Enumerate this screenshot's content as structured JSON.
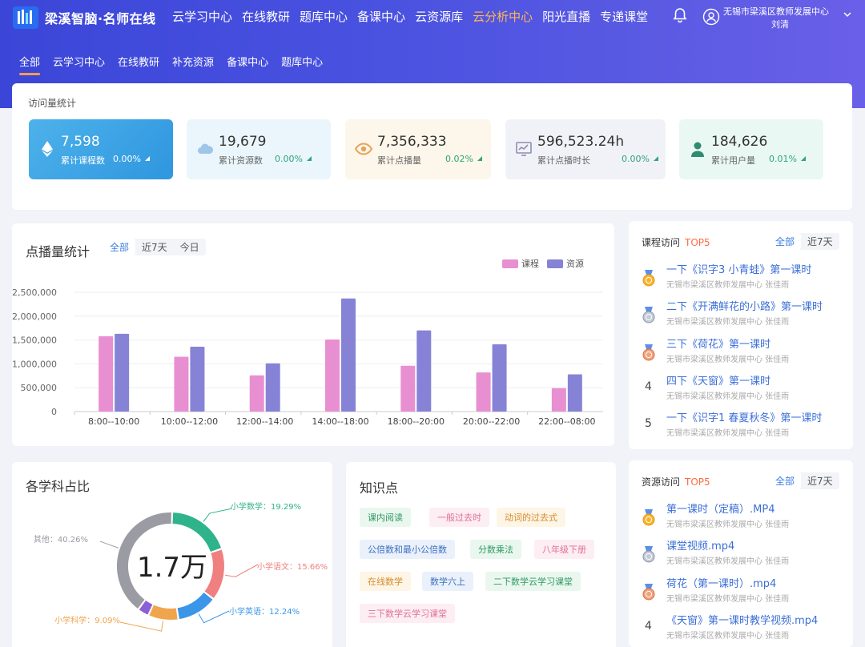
{
  "header": {
    "logo_text": "梁溪智脑·名师在线",
    "nav": [
      "云学习中心",
      "在线教研",
      "题库中心",
      "备课中心",
      "云资源库",
      "云分析中心",
      "阳光直播",
      "专递课堂"
    ],
    "active_nav": "云分析中心",
    "user_org": "无锡市梁溪区教师发展中心",
    "user_name": "刘清"
  },
  "subnav": {
    "items": [
      "全部",
      "云学习中心",
      "在线教研",
      "补充资源",
      "备课中心",
      "题库中心"
    ],
    "active": "全部"
  },
  "stats": {
    "title": "访问量统计",
    "cards": [
      {
        "value": "7,598",
        "label": "累计课程数",
        "pct": "0.00%",
        "icon": "ethereum-icon"
      },
      {
        "value": "19,679",
        "label": "累计资源数",
        "pct": "0.00%",
        "icon": "cloud-icon"
      },
      {
        "value": "7,356,333",
        "label": "累计点播量",
        "pct": "0.02%",
        "icon": "eye-icon"
      },
      {
        "value": "596,523.24h",
        "label": "累计点播时长",
        "pct": "0.00%",
        "icon": "monitor-chart-icon"
      },
      {
        "value": "184,626",
        "label": "累计用户量",
        "pct": "0.01%",
        "icon": "user-icon"
      }
    ]
  },
  "play_chart": {
    "title": "点播量统计",
    "filters": [
      "全部",
      "近7天",
      "今日"
    ],
    "active_filter": "全部"
  },
  "chart_data": {
    "type": "bar",
    "categories": [
      "8:00--10:00",
      "10:00--12:00",
      "12:00--14:00",
      "14:00--18:00",
      "18:00--20:00",
      "20:00--22:00",
      "22:00--08:00"
    ],
    "series": [
      {
        "name": "课程",
        "values": [
          1580000,
          1150000,
          760000,
          1510000,
          960000,
          820000,
          490000
        ],
        "color": "#e88fd1"
      },
      {
        "name": "资源",
        "values": [
          1630000,
          1360000,
          1010000,
          2370000,
          1700000,
          1410000,
          780000
        ],
        "color": "#8683d6"
      }
    ],
    "yticks": [
      "2,500,000",
      "2,000,000",
      "1,500,000",
      "1,000,000",
      "500,000",
      "0"
    ],
    "ylim": [
      0,
      2500000
    ]
  },
  "course_rank": {
    "title": "课程访问",
    "badge": "TOP5",
    "filters": [
      "全部",
      "近7天"
    ],
    "items": [
      {
        "rank": "1",
        "title": "一下《识字3 小青蛙》第一课时",
        "sub": "无锡市梁溪区教师发展中心 张佳雨"
      },
      {
        "rank": "2",
        "title": "二下《开满鲜花的小路》第一课时",
        "sub": "无锡市梁溪区教师发展中心 张佳雨"
      },
      {
        "rank": "3",
        "title": "三下《荷花》第一课时",
        "sub": "无锡市梁溪区教师发展中心 张佳雨"
      },
      {
        "rank": "4",
        "title": "四下《天窗》第一课时",
        "sub": "无锡市梁溪区教师发展中心 张佳雨"
      },
      {
        "rank": "5",
        "title": "一下《识字1 春夏秋冬》第一课时",
        "sub": "无锡市梁溪区教师发展中心 张佳雨"
      }
    ]
  },
  "resource_rank": {
    "title": "资源访问",
    "badge": "TOP5",
    "filters": [
      "全部",
      "近7天"
    ],
    "items": [
      {
        "rank": "1",
        "title": "第一课时（定稿）.MP4",
        "sub": "无锡市梁溪区教师发展中心 张佳雨"
      },
      {
        "rank": "2",
        "title": "课堂视频.mp4",
        "sub": "无锡市梁溪区教师发展中心 张佳雨"
      },
      {
        "rank": "3",
        "title": "荷花（第一课时）.mp4",
        "sub": "无锡市梁溪区教师发展中心 张佳雨"
      },
      {
        "rank": "4",
        "title": "《天窗》第一课时教学视频.mp4",
        "sub": "无锡市梁溪区教师发展中心 张佳雨"
      }
    ]
  },
  "subjects": {
    "title": "各学科占比",
    "center": "1.7万",
    "slices": [
      {
        "name": "小学数学",
        "pct": "19.29%",
        "value": 19.29,
        "color": "#2fb38a"
      },
      {
        "name": "小学语文",
        "pct": "15.66%",
        "value": 15.66,
        "color": "#f07f7f"
      },
      {
        "name": "小学英语",
        "pct": "12.24%",
        "value": 12.24,
        "color": "#3b96e8"
      },
      {
        "name": "小学科学",
        "pct": "9.09%",
        "value": 9.09,
        "color": "#f0a54c"
      },
      {
        "name": "",
        "pct": "",
        "value": 3.46,
        "color": "#8b5fd6"
      },
      {
        "name": "其他",
        "pct": "40.26%",
        "value": 40.26,
        "color": "#9a9ba3"
      }
    ]
  },
  "knowledge": {
    "title": "知识点",
    "tags": [
      "课内阅读",
      "一般过去时",
      "动词的过去式",
      "公倍数和最小公倍数",
      "分数乘法",
      "八年级下册",
      "在线数学",
      "数学六上",
      "二下数学云学习课堂",
      "三下数学云学习课堂"
    ]
  }
}
